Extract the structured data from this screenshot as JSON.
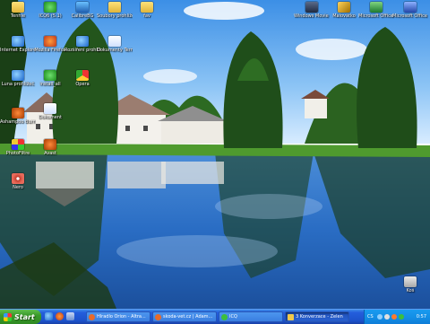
{
  "desktop": {
    "icons": [
      {
        "label": "Tenhle",
        "glyph": "folder-icon",
        "cls": "g-folder"
      },
      {
        "label": "ICQ6 (5.1)",
        "glyph": "icq-flower-icon",
        "cls": "g-clover"
      },
      {
        "label": "CalibreBG",
        "glyph": "media-icon",
        "cls": "g-media"
      },
      {
        "label": "Soubory prohlížeč",
        "glyph": "folder-icon",
        "cls": "g-folder"
      },
      {
        "label": "fav",
        "glyph": "folder-icon",
        "cls": "g-folder"
      },
      {
        "label": "Windows Movie Maker",
        "glyph": "movie-maker-icon",
        "cls": "g-camera"
      },
      {
        "label": "Malovátko",
        "glyph": "paint-icon",
        "cls": "g-pen"
      },
      {
        "label": "Microsoft Office Excel",
        "glyph": "excel-icon",
        "cls": "g-excel"
      },
      {
        "label": "Microsoft Office Word",
        "glyph": "word-icon",
        "cls": "g-word"
      },
      {
        "label": "Internet Explorer",
        "glyph": "internet-explorer-icon",
        "cls": "g-ie"
      },
      {
        "label": "Mozilla Firefox",
        "glyph": "firefox-icon",
        "cls": "g-bird"
      },
      {
        "label": "Avast",
        "glyph": "tool-icon",
        "cls": "g-tool"
      },
      {
        "label": "Rozšíření prohlížeč",
        "glyph": "ie-icon",
        "cls": "g-ie"
      },
      {
        "label": "Dokumenty Termín",
        "glyph": "document-icon",
        "cls": "g-doc"
      },
      {
        "label": "Luna prohlížeč",
        "glyph": "globe-icon",
        "cls": "g-ie"
      },
      {
        "label": "install_all",
        "glyph": "icq-flower-icon",
        "cls": "g-clover"
      },
      {
        "label": "Opera",
        "glyph": "chrome-icon",
        "cls": "g-chrome"
      },
      {
        "label": "Ashampoo Burning Studio",
        "glyph": "burn-icon",
        "cls": "g-tool"
      },
      {
        "label": "Dokument",
        "glyph": "document-icon",
        "cls": "g-doc"
      },
      {
        "label": "PhotoFiltre",
        "glyph": "photo-icon",
        "cls": "g-photo"
      },
      {
        "label": "Nero",
        "glyph": "disc-icon",
        "cls": "g-disc"
      },
      {
        "label": "Koš",
        "glyph": "recycle-bin-icon",
        "cls": "g-trash"
      }
    ]
  },
  "taskbar": {
    "start_label": "Start",
    "quick_launch": [
      "ie-icon",
      "firefox-icon",
      "desktop-icon"
    ],
    "tasks": [
      {
        "label": "Hlradlo Orion - Altra...",
        "icon": "firefox-icon",
        "color": "#e86a2a",
        "active": false
      },
      {
        "label": "skoda-vet.cz | Adam...",
        "icon": "firefox-icon",
        "color": "#e86a2a",
        "active": false
      },
      {
        "label": "ICQ",
        "icon": "icq-flower-icon",
        "color": "#3cbf3c",
        "active": false
      },
      {
        "label": "3 Konverzace - Zelen",
        "icon": "folder-icon",
        "color": "#f0c84a",
        "active": true
      }
    ],
    "tray": {
      "language": "CS",
      "icons": [
        "network-icon",
        "volume-icon",
        "antivirus-icon",
        "icq-tray-icon"
      ],
      "clock": "0:57"
    }
  },
  "colors": {
    "taskbar_blue": "#245edc",
    "start_green": "#3a9a2a",
    "tray_blue": "#138fe6"
  }
}
